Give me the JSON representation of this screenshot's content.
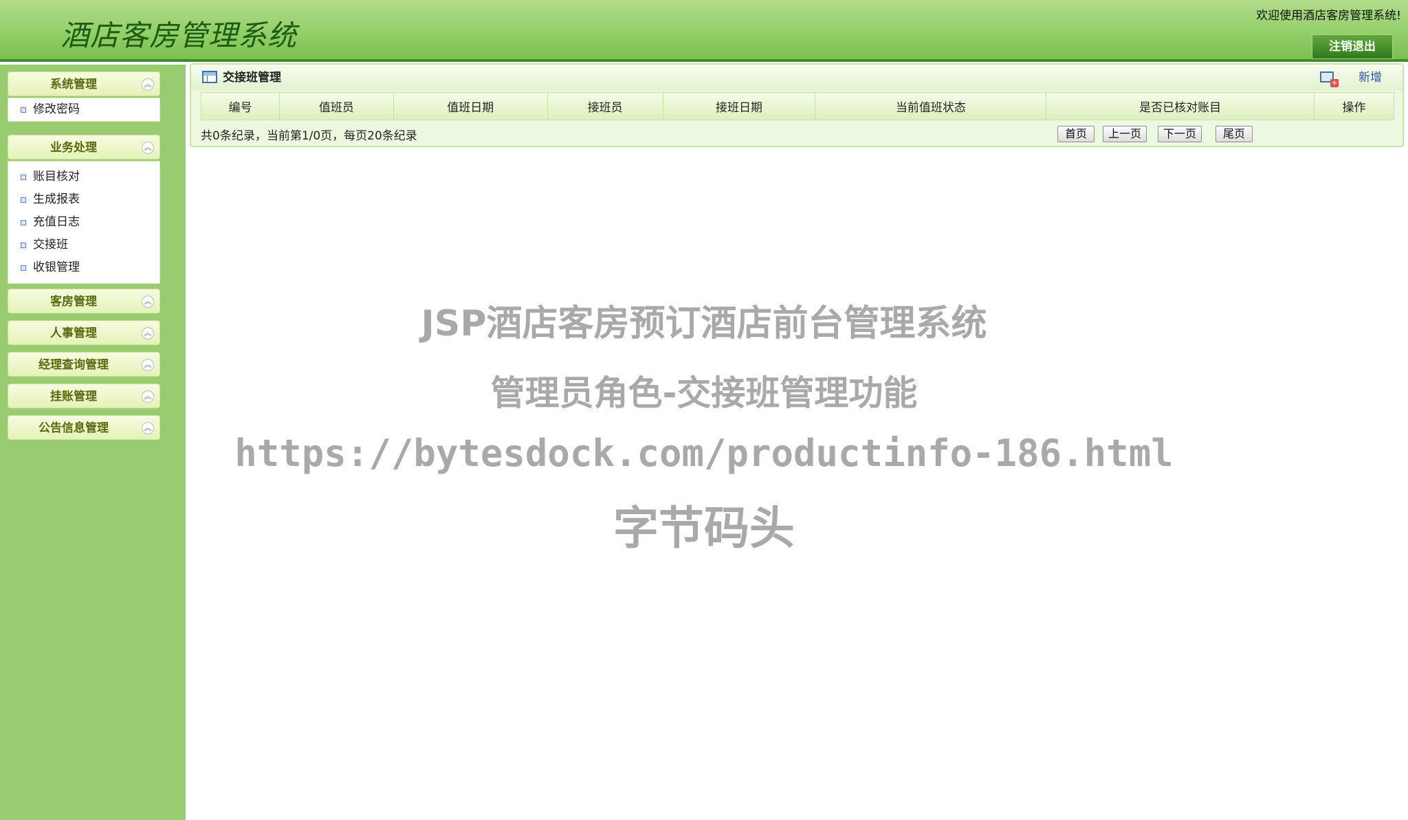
{
  "header": {
    "title": "酒店客房管理系统",
    "welcome": "欢迎使用酒店客房管理系统!",
    "logout": "注销退出"
  },
  "sidebar": {
    "groups": [
      {
        "label": "系统管理",
        "items": [
          "修改密码"
        ]
      },
      {
        "label": "业务处理",
        "items": [
          "账目核对",
          "生成报表",
          "充值日志",
          "交接班",
          "收银管理"
        ]
      },
      {
        "label": "客房管理"
      },
      {
        "label": "人事管理"
      },
      {
        "label": "经理查询管理"
      },
      {
        "label": "挂账管理"
      },
      {
        "label": "公告信息管理"
      }
    ]
  },
  "main": {
    "title": "交接班管理",
    "add": "新增",
    "columns": [
      "编号",
      "值班员",
      "值班日期",
      "接班员",
      "接班日期",
      "当前值班状态",
      "是否已核对账目",
      "操作"
    ],
    "pager_info": "共0条纪录，当前第1/0页，每页20条纪录",
    "pager_buttons": [
      "首页",
      "上一页",
      "下一页",
      "尾页"
    ]
  },
  "watermark": {
    "line1": "JSP酒店客房预订酒店前台管理系统",
    "line2": "管理员角色-交接班管理功能",
    "line3": "https://bytesdock.com/productinfo-186.html",
    "line4": "字节码头"
  }
}
